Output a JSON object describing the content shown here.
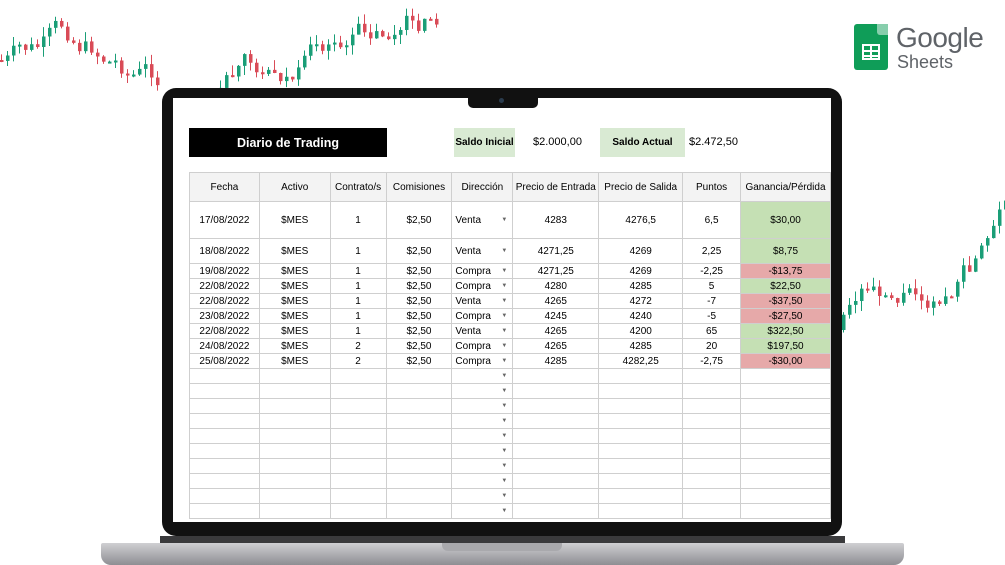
{
  "brand": {
    "word1": "Google",
    "word2": "Sheets",
    "logo_icon": "google-sheets-icon",
    "accent": "#0f9d58"
  },
  "sheet": {
    "title": "Diario de Trading",
    "saldo_inicial_label": "Saldo Inicial",
    "saldo_inicial_value": "$2.000,00",
    "saldo_actual_label": "Saldo Actual",
    "saldo_actual_value": "$2.472,50",
    "headers": [
      "Fecha",
      "Activo",
      "Contrato/s",
      "Comisiones",
      "Dirección",
      "Precio de Entrada",
      "Precio de Salida",
      "Puntos",
      "Ganancia/Pérdida"
    ],
    "rows": [
      {
        "fecha": "17/08/2022",
        "activo": "$MES",
        "contratos": "1",
        "comisiones": "$2,50",
        "direccion": "Venta",
        "entrada": "4283",
        "salida": "4276,5",
        "puntos": "6,5",
        "pl": "$30,00",
        "pl_status": "pos"
      },
      {
        "fecha": "18/08/2022",
        "activo": "$MES",
        "contratos": "1",
        "comisiones": "$2,50",
        "direccion": "Venta",
        "entrada": "4271,25",
        "salida": "4269",
        "puntos": "2,25",
        "pl": "$8,75",
        "pl_status": "pos"
      },
      {
        "fecha": "19/08/2022",
        "activo": "$MES",
        "contratos": "1",
        "comisiones": "$2,50",
        "direccion": "Compra",
        "entrada": "4271,25",
        "salida": "4269",
        "puntos": "-2,25",
        "pl": "-$13,75",
        "pl_status": "neg"
      },
      {
        "fecha": "22/08/2022",
        "activo": "$MES",
        "contratos": "1",
        "comisiones": "$2,50",
        "direccion": "Compra",
        "entrada": "4280",
        "salida": "4285",
        "puntos": "5",
        "pl": "$22,50",
        "pl_status": "pos"
      },
      {
        "fecha": "22/08/2022",
        "activo": "$MES",
        "contratos": "1",
        "comisiones": "$2,50",
        "direccion": "Venta",
        "entrada": "4265",
        "salida": "4272",
        "puntos": "-7",
        "pl": "-$37,50",
        "pl_status": "neg"
      },
      {
        "fecha": "23/08/2022",
        "activo": "$MES",
        "contratos": "1",
        "comisiones": "$2,50",
        "direccion": "Compra",
        "entrada": "4245",
        "salida": "4240",
        "puntos": "-5",
        "pl": "-$27,50",
        "pl_status": "neg"
      },
      {
        "fecha": "22/08/2022",
        "activo": "$MES",
        "contratos": "1",
        "comisiones": "$2,50",
        "direccion": "Venta",
        "entrada": "4265",
        "salida": "4200",
        "puntos": "65",
        "pl": "$322,50",
        "pl_status": "pos"
      },
      {
        "fecha": "24/08/2022",
        "activo": "$MES",
        "contratos": "2",
        "comisiones": "$2,50",
        "direccion": "Compra",
        "entrada": "4265",
        "salida": "4285",
        "puntos": "20",
        "pl": "$197,50",
        "pl_status": "pos"
      },
      {
        "fecha": "25/08/2022",
        "activo": "$MES",
        "contratos": "2",
        "comisiones": "$2,50",
        "direccion": "Compra",
        "entrada": "4285",
        "salida": "4282,25",
        "puntos": "-2,75",
        "pl": "-$30,00",
        "pl_status": "neg"
      }
    ],
    "empty_rows": 10,
    "dropdown_icon": "chevron-down-icon",
    "colors": {
      "positive": "#c5e0b4",
      "negative": "#e6a9a9",
      "label_bg": "#d9ead3"
    }
  },
  "background": {
    "candle_up": "#1a9e77",
    "candle_down": "#d94b57"
  }
}
